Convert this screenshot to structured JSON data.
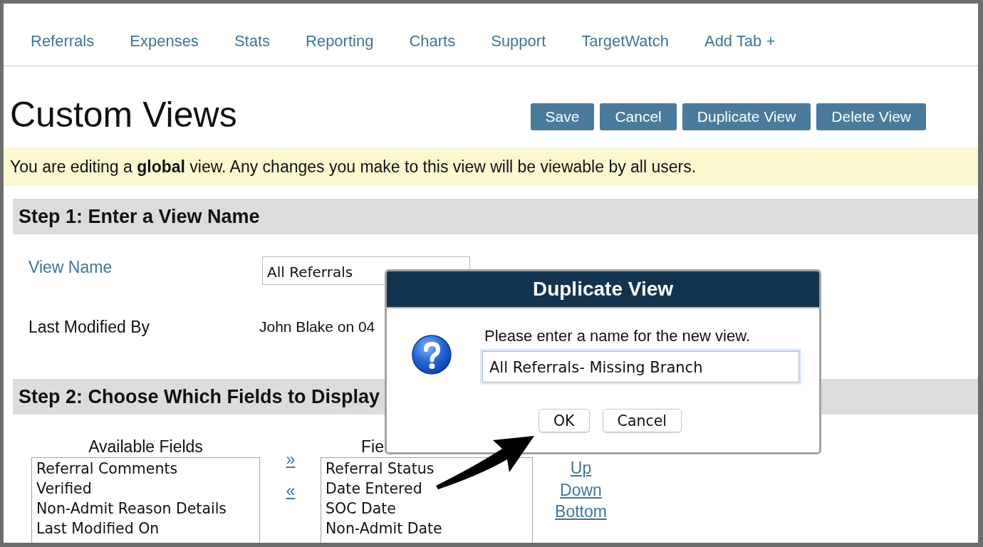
{
  "nav_tabs": [
    {
      "label": "Referrals",
      "selected": false
    },
    {
      "label": "Expenses",
      "selected": false
    },
    {
      "label": "Stats",
      "selected": false
    },
    {
      "label": "Reporting",
      "selected": false
    },
    {
      "label": "Charts",
      "selected": false
    },
    {
      "label": "Support",
      "selected": false
    },
    {
      "label": "TargetWatch",
      "selected": false
    },
    {
      "label": "Add Tab +",
      "selected": false
    }
  ],
  "page_title": "Custom Views",
  "header_buttons": [
    "Save",
    "Cancel",
    "Duplicate View",
    "Delete View"
  ],
  "notice": "You are editing a **global** view. Any changes you make to this view will be viewable by all users.",
  "step1": {
    "title": "Step 1: Enter a View Name",
    "fields": [
      {
        "kind": "input",
        "label": "View Name",
        "value": "All Referrals"
      },
      {
        "kind": "text",
        "label": "Last Modified By",
        "value": "John Blake on 04"
      }
    ]
  },
  "step2": {
    "title": "Step 2: Choose Which Fields to Display",
    "available_fields": {
      "header": "Available Fields",
      "items": [
        "Referral Comments",
        "Verified",
        "Non-Admit Reason Details",
        "Last Modified On"
      ]
    },
    "move_links": [
      "»",
      "«"
    ],
    "displayed_fields": {
      "header": "Fie",
      "items": [
        "Referral Status",
        "Date Entered",
        "SOC Date",
        "Non-Admit Date"
      ]
    },
    "order_links": [
      "Up",
      "Down",
      "Bottom"
    ]
  },
  "dialog": {
    "title": "Duplicate View",
    "prompt": "Please enter a name for the new view.",
    "value": "All Referrals- Missing Branch",
    "buttons": [
      "OK",
      "Cancel"
    ]
  }
}
